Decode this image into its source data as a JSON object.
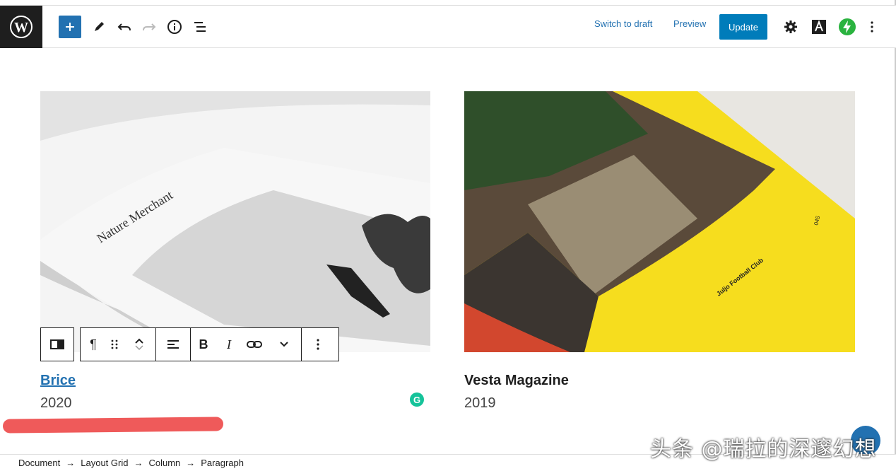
{
  "toolbar": {
    "switch_to_draft": "Switch to draft",
    "preview": "Preview",
    "update": "Update"
  },
  "images": [
    {
      "title": "Brice",
      "year": "2020",
      "book_title": "Nature Merchant"
    },
    {
      "title": "Vesta Magazine",
      "year": "2019",
      "page_caption": "Juljo Football Club",
      "page_number": "045"
    }
  ],
  "breadcrumb": [
    "Document",
    "Layout Grid",
    "Column",
    "Paragraph"
  ],
  "watermark": "头条 @瑞拉的深邃幻想",
  "colors": {
    "accent": "#2271b1",
    "update_button": "#007cba",
    "highlight": "#ef5a5a",
    "magazine_yellow": "#f6dd1e"
  },
  "icons": [
    "wordpress-logo-icon",
    "plus-icon",
    "pen-icon",
    "undo-icon",
    "redo-icon",
    "info-icon",
    "list-view-icon",
    "gear-icon",
    "text-style-icon",
    "bolt-icon",
    "more-vertical-icon",
    "column-icon",
    "paragraph-icon",
    "drag-handle-icon",
    "move-up-icon",
    "move-down-icon",
    "align-left-icon",
    "bold-icon",
    "italic-icon",
    "link-icon",
    "chevron-down-icon",
    "grammarly-icon"
  ]
}
